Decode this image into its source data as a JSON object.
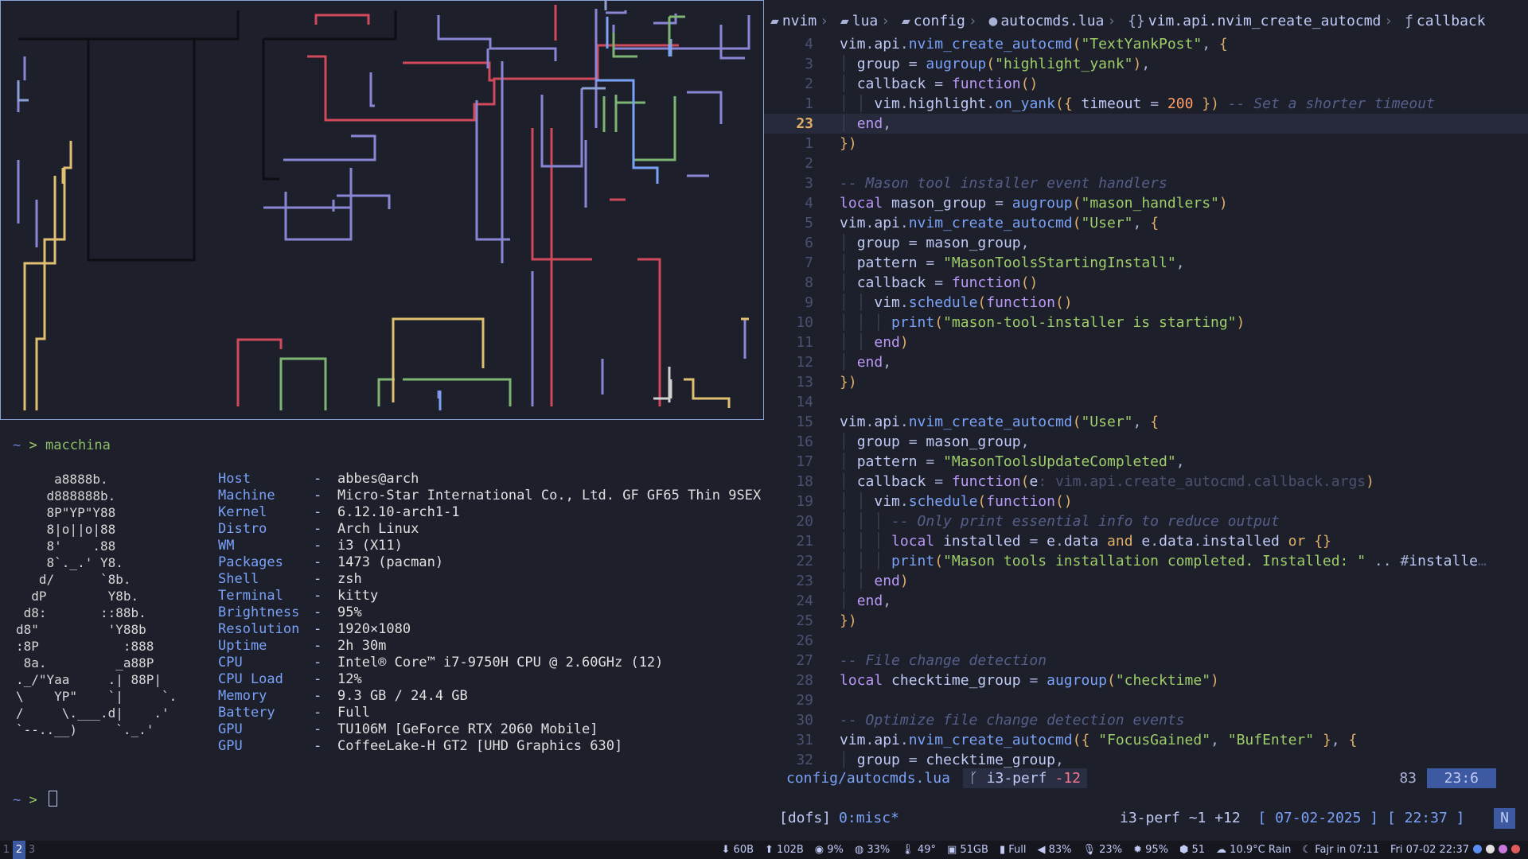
{
  "terminal": {
    "prompt_tilde": "~",
    "prompt_arrow": ">",
    "command": "macchina",
    "logo": "     a8888b.\n    d888888b.\n    8P\"YP\"Y88\n    8|o||o|88\n    8'    .88\n    8`._.' Y8.\n   d/      `8b.\n  dP        Y8b.\n d8:       ::88b.\nd8\"         'Y88b\n:8P           :888\n 8a.         _a88P\n._/\"Yaa     .| 88P|\n\\    YP\"    `|     `.\n/     \\.___.d|    .'\n`--..__)     `._.'",
    "info": [
      {
        "key": "Host",
        "value": "abbes@arch"
      },
      {
        "key": "Machine",
        "value": "Micro-Star International Co., Ltd. GF GF65 Thin 9SEX"
      },
      {
        "key": "Kernel",
        "value": "6.12.10-arch1-1"
      },
      {
        "key": "Distro",
        "value": "Arch Linux"
      },
      {
        "key": "WM",
        "value": "i3 (X11)"
      },
      {
        "key": "Packages",
        "value": "1473 (pacman)"
      },
      {
        "key": "Shell",
        "value": "zsh"
      },
      {
        "key": "Terminal",
        "value": "kitty"
      },
      {
        "key": "Brightness",
        "value": "95%"
      },
      {
        "key": "Resolution",
        "value": "1920×1080"
      },
      {
        "key": "Uptime",
        "value": "2h 30m"
      },
      {
        "key": "CPU",
        "value": "Intel® Core™ i7-9750H CPU @ 2.60GHz (12)"
      },
      {
        "key": "CPU Load",
        "value": "12%"
      },
      {
        "key": "Memory",
        "value": "9.3 GB / 24.4 GB"
      },
      {
        "key": "Battery",
        "value": "Full"
      },
      {
        "key": "GPU",
        "value": "TU106M [GeForce RTX 2060 Mobile]"
      },
      {
        "key": "GPU",
        "value": "CoffeeLake-H GT2 [UHD Graphics 630]"
      }
    ],
    "info_separator": "-"
  },
  "editor": {
    "breadcrumb": [
      "nvim",
      "lua",
      "config",
      "autocmds.lua",
      "vim.api.nvim_create_autocmd",
      "callback"
    ],
    "statusline": {
      "file": "config/autocmds.lua",
      "branch": "i3-perf",
      "diff": "-12",
      "lines": "83",
      "position": "23:6"
    }
  },
  "tmux": {
    "session": "[dofs]",
    "window": "0:misc*",
    "git": "i3-perf ~1 +12",
    "date": "[ 07-02-2025 ] [ 22:37 ]",
    "mode": "N"
  },
  "bar": {
    "workspaces": [
      "1",
      "2",
      "3"
    ],
    "active_workspace": "2",
    "modules": [
      "60B",
      "102B",
      "9%",
      "33%",
      "49°",
      "51GB",
      "Full",
      "83%",
      "23%",
      "95%",
      "51",
      "10.9°C Rain",
      "Fajr in 07:11",
      "Fri 07-02 22:37"
    ]
  },
  "colors": {
    "accent": "#3d59a1",
    "keyword": "#bb9af7",
    "function": "#7aa2f7",
    "string": "#9ece6a",
    "number": "#ff9e64",
    "comment": "#565f89"
  }
}
